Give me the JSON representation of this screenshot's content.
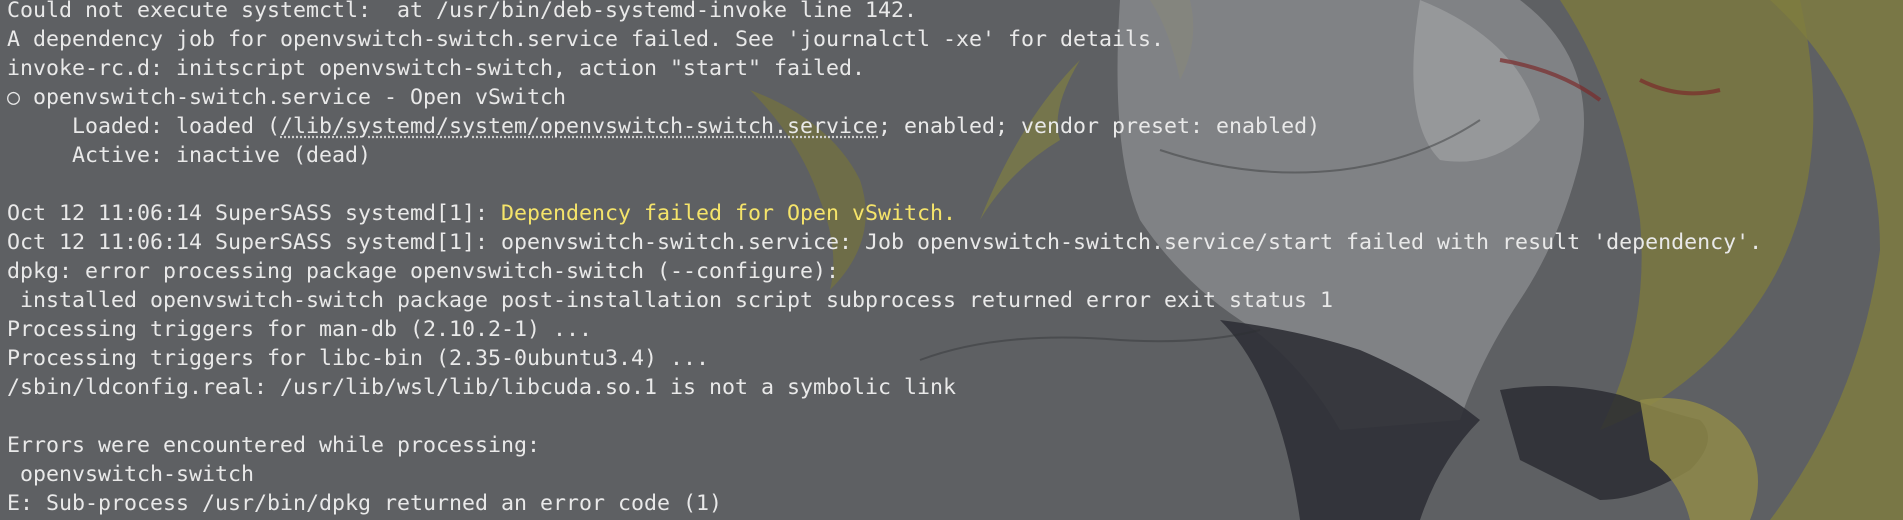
{
  "terminal": {
    "lines": [
      {
        "text": "Could not execute systemctl:  at /usr/bin/deb-systemd-invoke line 142."
      },
      {
        "text": "A dependency job for openvswitch-switch.service failed. See 'journalctl -xe' for details."
      },
      {
        "text": "invoke-rc.d: initscript openvswitch-switch, action \"start\" failed."
      },
      {
        "text": "○ openvswitch-switch.service - Open vSwitch"
      },
      {
        "pre": "     Loaded: loaded (",
        "link": "/lib/systemd/system/openvswitch-switch.service",
        "post": "; enabled; vendor preset: enabled)"
      },
      {
        "text": "     Active: inactive (dead)"
      },
      {
        "text": ""
      },
      {
        "pre": "Oct 12 11:06:14 SuperSASS systemd[1]: ",
        "highlight": "Dependency failed for Open vSwitch."
      },
      {
        "text": "Oct 12 11:06:14 SuperSASS systemd[1]: openvswitch-switch.service: Job openvswitch-switch.service/start failed with result 'dependency'."
      },
      {
        "text": "dpkg: error processing package openvswitch-switch (--configure):"
      },
      {
        "text": " installed openvswitch-switch package post-installation script subprocess returned error exit status 1"
      },
      {
        "text": "Processing triggers for man-db (2.10.2-1) ..."
      },
      {
        "text": "Processing triggers for libc-bin (2.35-0ubuntu3.4) ..."
      },
      {
        "text": "/sbin/ldconfig.real: /usr/lib/wsl/lib/libcuda.so.1 is not a symbolic link"
      },
      {
        "text": ""
      },
      {
        "text": "Errors were encountered while processing:"
      },
      {
        "text": " openvswitch-switch"
      },
      {
        "text": "E: Sub-process /usr/bin/dpkg returned an error code (1)"
      }
    ]
  },
  "colors": {
    "background": "#5e6063",
    "text": "#e9e9e9",
    "highlight": "#f5e46a"
  }
}
